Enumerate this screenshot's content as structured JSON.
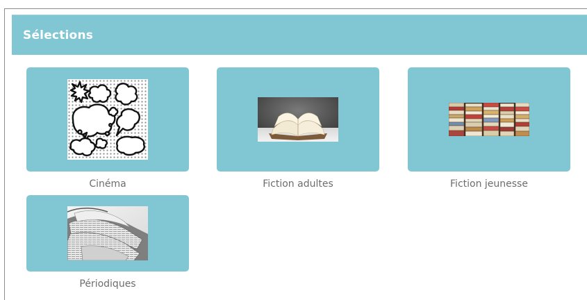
{
  "panel": {
    "title": "Sélections"
  },
  "tiles": [
    {
      "label": "Cinéma",
      "image": "comic-speech-bubbles"
    },
    {
      "label": "Fiction adultes",
      "image": "open-book"
    },
    {
      "label": "Fiction jeunesse",
      "image": "stacked-books"
    },
    {
      "label": "Périodiques",
      "image": "newspapers"
    }
  ],
  "colors": {
    "accent": "#80c6d3",
    "label": "#6d6d6d"
  }
}
